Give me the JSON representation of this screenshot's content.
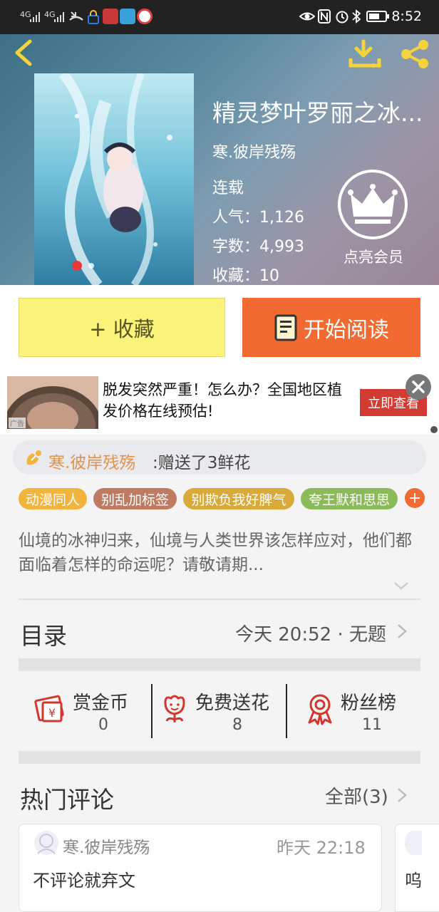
{
  "status_bar": {
    "signal_1": "4G",
    "signal_2": "4G",
    "time": "8:52"
  },
  "header": {
    "title": "精灵梦叶罗丽之冰...",
    "author": "寒.彼岸残殇",
    "status": "连载",
    "popularity": "人气：1,126",
    "word_count": "字数：4,993",
    "favorites": "收藏：10",
    "vip_label": "点亮会员"
  },
  "actions": {
    "collect_label": "+ 收藏",
    "read_label": "开始阅读"
  },
  "ad": {
    "text": "脱发突然严重！怎么办？全国地区植发价格在线预估!",
    "cta": "立即查看",
    "badge": "广告"
  },
  "gift": {
    "name": "寒.彼岸残殇",
    "text": ":赠送了3鲜花"
  },
  "tags": [
    {
      "label": "动漫同人",
      "color": "#f2b43c"
    },
    {
      "label": "别乱加标签",
      "color": "#c07a62"
    },
    {
      "label": "别欺负我好脾气",
      "color": "#d9a93a"
    },
    {
      "label": "夸王默和思思",
      "color": "#8bbb58"
    }
  ],
  "tag_more": "+",
  "description": "仙境的冰神归来，仙境与人类世界该怎样应对，他们都面临着怎样的命运呢？请敬请期...",
  "toc": {
    "title": "目录",
    "latest": "今天 20:52 · 无题"
  },
  "stats": [
    {
      "label": "赏金币",
      "value": "0"
    },
    {
      "label": "免费送花",
      "value": "8"
    },
    {
      "label": "粉丝榜",
      "value": "11"
    }
  ],
  "comments": {
    "title": "热门评论",
    "all_label": "全部(3)",
    "items": [
      {
        "user": "寒.彼岸残殇",
        "time": "昨天 22:18",
        "text": "不评论就弃文"
      },
      {
        "text": "呜"
      }
    ]
  },
  "colors": {
    "accent_orange": "#f06a32",
    "collect_yellow": "#fcf47a",
    "gift_orange": "#e2934c",
    "icon_red": "#d2372d",
    "header_icon_yellow": "#f5d33a"
  }
}
